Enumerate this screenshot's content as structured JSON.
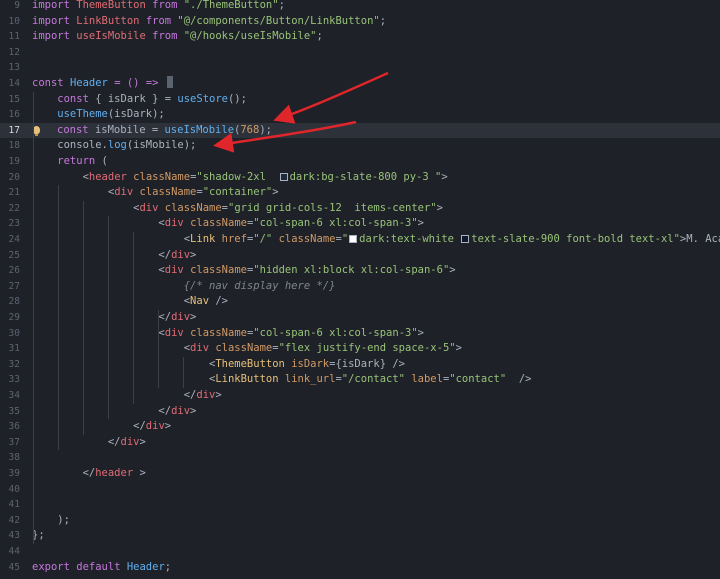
{
  "editor": {
    "first_line": 9,
    "active_line": 17,
    "lines": [
      [
        {
          "t": "import ",
          "c": "k"
        },
        {
          "t": "ThemeButton ",
          "c": "v"
        },
        {
          "t": "from ",
          "c": "k"
        },
        {
          "t": "\"./ThemeButton\"",
          "c": "s"
        },
        {
          "t": ";",
          "c": "p"
        }
      ],
      [
        {
          "t": "import ",
          "c": "k"
        },
        {
          "t": "LinkButton ",
          "c": "v"
        },
        {
          "t": "from ",
          "c": "k"
        },
        {
          "t": "\"@/components/Button/LinkButton\"",
          "c": "s"
        },
        {
          "t": ";",
          "c": "p"
        }
      ],
      [
        {
          "t": "import ",
          "c": "k"
        },
        {
          "t": "useIsMobile ",
          "c": "v"
        },
        {
          "t": "from ",
          "c": "k"
        },
        {
          "t": "\"@/hooks/useIsMobile\"",
          "c": "s"
        },
        {
          "t": ";",
          "c": "p"
        }
      ],
      [],
      [],
      [
        {
          "t": "const ",
          "c": "k"
        },
        {
          "t": "Header ",
          "c": "f"
        },
        {
          "t": "= () => ",
          "c": "k"
        },
        {
          "cursor": true
        }
      ],
      [
        {
          "t": "    const ",
          "c": "k"
        },
        {
          "t": "{ isDark } = ",
          "c": "p"
        },
        {
          "t": "useStore",
          "c": "f"
        },
        {
          "t": "();",
          "c": "p"
        }
      ],
      [
        {
          "t": "    useTheme",
          "c": "f"
        },
        {
          "t": "(isDark);",
          "c": "p"
        }
      ],
      [
        {
          "t": "    const ",
          "c": "k"
        },
        {
          "t": "isMobile = ",
          "c": "p"
        },
        {
          "t": "useIsMobile",
          "c": "f"
        },
        {
          "t": "(",
          "c": "p"
        },
        {
          "t": "768",
          "c": "n"
        },
        {
          "t": ");",
          "c": "p"
        }
      ],
      [
        {
          "t": "    console",
          "c": "p"
        },
        {
          "t": ".",
          "c": "p"
        },
        {
          "t": "log",
          "c": "f"
        },
        {
          "t": "(isMobile);",
          "c": "p"
        }
      ],
      [
        {
          "t": "    return ",
          "c": "k"
        },
        {
          "t": "(",
          "c": "p"
        }
      ],
      [
        {
          "t": "        <",
          "c": "p"
        },
        {
          "t": "header ",
          "c": "tag"
        },
        {
          "t": "className",
          "c": "attr"
        },
        {
          "t": "=",
          "c": "p"
        },
        {
          "t": "\"shadow-2xl  ",
          "c": "s"
        },
        {
          "swatch": "#1e293b"
        },
        {
          "t": "dark:bg-slate-800 py-3 \"",
          "c": "s"
        },
        {
          "t": ">",
          "c": "p"
        }
      ],
      [
        {
          "t": "            <",
          "c": "p"
        },
        {
          "t": "div ",
          "c": "tag"
        },
        {
          "t": "className",
          "c": "attr"
        },
        {
          "t": "=",
          "c": "p"
        },
        {
          "t": "\"container\"",
          "c": "s"
        },
        {
          "t": ">",
          "c": "p"
        }
      ],
      [
        {
          "t": "                <",
          "c": "p"
        },
        {
          "t": "div ",
          "c": "tag"
        },
        {
          "t": "className",
          "c": "attr"
        },
        {
          "t": "=",
          "c": "p"
        },
        {
          "t": "\"grid grid-cols-12  items-center\"",
          "c": "s"
        },
        {
          "t": ">",
          "c": "p"
        }
      ],
      [
        {
          "t": "                    <",
          "c": "p"
        },
        {
          "t": "div ",
          "c": "tag"
        },
        {
          "t": "className",
          "c": "attr"
        },
        {
          "t": "=",
          "c": "p"
        },
        {
          "t": "\"col-span-6 xl:col-span-3\"",
          "c": "s"
        },
        {
          "t": ">",
          "c": "p"
        }
      ],
      [
        {
          "t": "                        <",
          "c": "p"
        },
        {
          "t": "Link ",
          "c": "cmp"
        },
        {
          "t": "href",
          "c": "attr"
        },
        {
          "t": "=",
          "c": "p"
        },
        {
          "t": "\"/\" ",
          "c": "s"
        },
        {
          "t": "className",
          "c": "attr"
        },
        {
          "t": "=",
          "c": "p"
        },
        {
          "t": "\"",
          "c": "s"
        },
        {
          "swatch": "#ffffff"
        },
        {
          "t": "dark:text-white ",
          "c": "s"
        },
        {
          "swatch": "#0f172a"
        },
        {
          "t": "text-slate-900 font-bold text-xl\"",
          "c": "s"
        },
        {
          "t": ">M. Aca",
          "c": "p"
        }
      ],
      [
        {
          "t": "                    </",
          "c": "p"
        },
        {
          "t": "div",
          "c": "tag"
        },
        {
          "t": ">",
          "c": "p"
        }
      ],
      [
        {
          "t": "                    <",
          "c": "p"
        },
        {
          "t": "div ",
          "c": "tag"
        },
        {
          "t": "className",
          "c": "attr"
        },
        {
          "t": "=",
          "c": "p"
        },
        {
          "t": "\"hidden xl:block xl:col-span-6\"",
          "c": "s"
        },
        {
          "t": ">",
          "c": "p"
        }
      ],
      [
        {
          "t": "                        ",
          "c": "p"
        },
        {
          "t": "{/* nav display here */}",
          "c": "c"
        }
      ],
      [
        {
          "t": "                        <",
          "c": "p"
        },
        {
          "t": "Nav ",
          "c": "cmp"
        },
        {
          "t": "/>",
          "c": "p"
        }
      ],
      [
        {
          "t": "                    </",
          "c": "p"
        },
        {
          "t": "div",
          "c": "tag"
        },
        {
          "t": ">",
          "c": "p"
        }
      ],
      [
        {
          "t": "                    <",
          "c": "p"
        },
        {
          "t": "div ",
          "c": "tag"
        },
        {
          "t": "className",
          "c": "attr"
        },
        {
          "t": "=",
          "c": "p"
        },
        {
          "t": "\"col-span-6 xl:col-span-3\"",
          "c": "s"
        },
        {
          "t": ">",
          "c": "p"
        }
      ],
      [
        {
          "t": "                        <",
          "c": "p"
        },
        {
          "t": "div ",
          "c": "tag"
        },
        {
          "t": "className",
          "c": "attr"
        },
        {
          "t": "=",
          "c": "p"
        },
        {
          "t": "\"flex justify-end space-x-5\"",
          "c": "s"
        },
        {
          "t": ">",
          "c": "p"
        }
      ],
      [
        {
          "t": "                            <",
          "c": "p"
        },
        {
          "t": "ThemeButton ",
          "c": "cmp"
        },
        {
          "t": "isDark",
          "c": "attr"
        },
        {
          "t": "=",
          "c": "p"
        },
        {
          "t": "{isDark} ",
          "c": "p"
        },
        {
          "t": "/>",
          "c": "p"
        }
      ],
      [
        {
          "t": "                            <",
          "c": "p"
        },
        {
          "t": "LinkButton ",
          "c": "cmp"
        },
        {
          "t": "link_url",
          "c": "attr"
        },
        {
          "t": "=",
          "c": "p"
        },
        {
          "t": "\"/contact\" ",
          "c": "s"
        },
        {
          "t": "label",
          "c": "attr"
        },
        {
          "t": "=",
          "c": "p"
        },
        {
          "t": "\"contact\"  ",
          "c": "s"
        },
        {
          "t": "/>",
          "c": "p"
        }
      ],
      [
        {
          "t": "                        </",
          "c": "p"
        },
        {
          "t": "div",
          "c": "tag"
        },
        {
          "t": ">",
          "c": "p"
        }
      ],
      [
        {
          "t": "                    </",
          "c": "p"
        },
        {
          "t": "div",
          "c": "tag"
        },
        {
          "t": ">",
          "c": "p"
        }
      ],
      [
        {
          "t": "                </",
          "c": "p"
        },
        {
          "t": "div",
          "c": "tag"
        },
        {
          "t": ">",
          "c": "p"
        }
      ],
      [
        {
          "t": "            </",
          "c": "p"
        },
        {
          "t": "div",
          "c": "tag"
        },
        {
          "t": ">",
          "c": "p"
        }
      ],
      [],
      [
        {
          "t": "        </",
          "c": "p"
        },
        {
          "t": "header ",
          "c": "tag"
        },
        {
          "t": ">",
          "c": "p"
        }
      ],
      [],
      [],
      [
        {
          "t": "    );",
          "c": "p"
        }
      ],
      [
        {
          "t": "};",
          "c": "p"
        }
      ],
      [],
      [
        {
          "t": "export ",
          "c": "k"
        },
        {
          "t": "default ",
          "c": "k"
        },
        {
          "t": "Header",
          "c": "f"
        },
        {
          "t": ";",
          "c": "p"
        }
      ]
    ]
  },
  "annotations": {
    "arrow_color": "#e0262b",
    "arrows_point_to_lines": [
      16,
      17
    ]
  }
}
